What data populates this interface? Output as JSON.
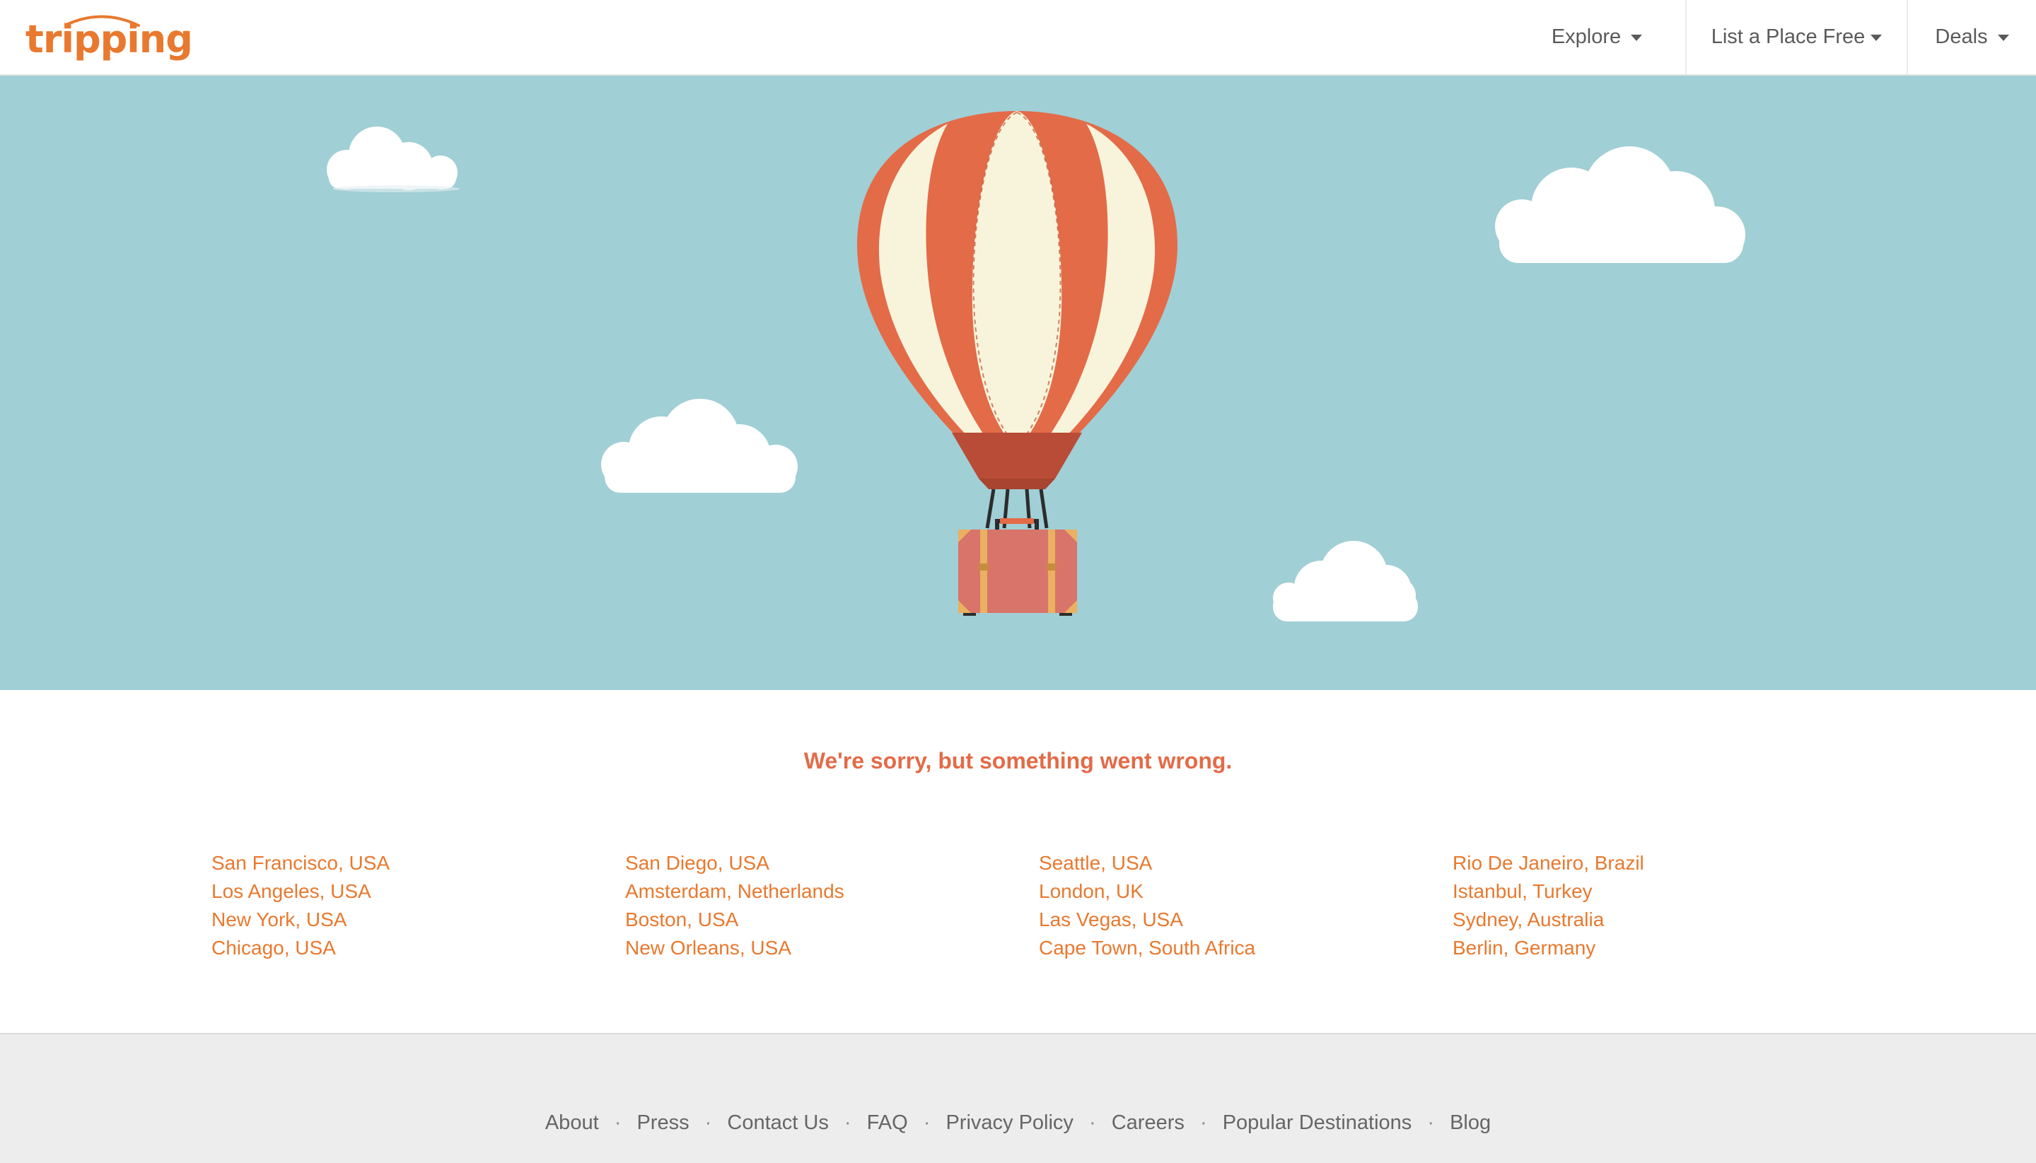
{
  "header": {
    "logo_text": "tripping",
    "nav": [
      {
        "label": "Explore",
        "icon": "caret-down-icon"
      },
      {
        "label": "List a Place Free",
        "icon": "caret-down-icon"
      },
      {
        "label": "Deals",
        "icon": "caret-down-icon"
      }
    ]
  },
  "colors": {
    "brand_orange": "#e8792f",
    "error_red": "#e36b48",
    "sky": "#a0cfd5",
    "balloon_stripe": "#e36b48",
    "balloon_cream": "#f8f4dc",
    "suitcase": "#d9746a",
    "footer_bg": "#ededed"
  },
  "hero": {
    "illustration": "hot-air-balloon-with-suitcase",
    "decor": [
      "cloud-icon",
      "cloud-icon",
      "cloud-icon",
      "cloud-icon"
    ]
  },
  "main": {
    "error_message": "We're sorry, but something went wrong.",
    "destinations": [
      [
        "San Francisco, USA",
        "Los Angeles, USA",
        "New York, USA",
        "Chicago, USA"
      ],
      [
        "San Diego, USA",
        "Amsterdam, Netherlands",
        "Boston, USA",
        "New Orleans, USA"
      ],
      [
        "Seattle, USA",
        "London, UK",
        "Las Vegas, USA",
        "Cape Town, South Africa"
      ],
      [
        "Rio De Janeiro, Brazil",
        "Istanbul, Turkey",
        "Sydney, Australia",
        "Berlin, Germany"
      ]
    ]
  },
  "footer": {
    "links": [
      "About",
      "Press",
      "Contact Us",
      "FAQ",
      "Privacy Policy",
      "Careers",
      "Popular Destinations",
      "Blog"
    ],
    "separator": "·"
  }
}
